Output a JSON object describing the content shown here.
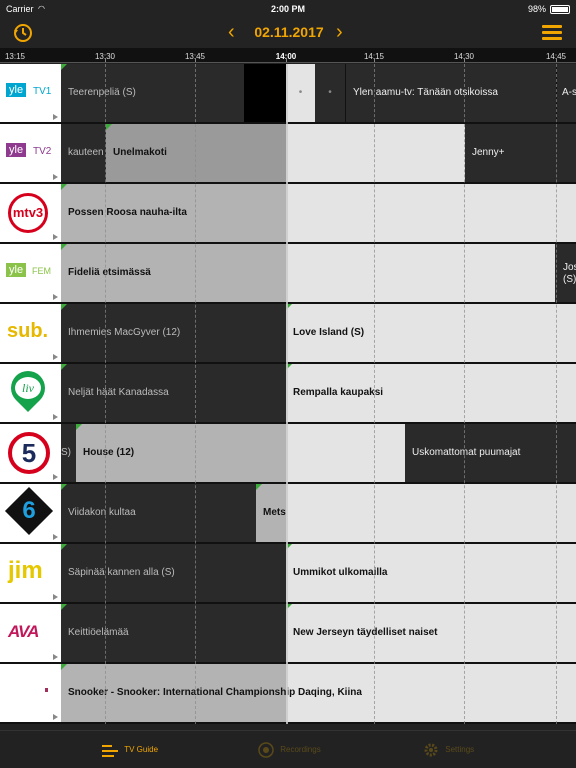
{
  "status": {
    "carrier": "Carrier",
    "time": "2:00 PM",
    "battery": "98%"
  },
  "nav": {
    "date": "02.11.2017",
    "history_icon": "history-clock-icon",
    "menu_icon": "hamburger-menu-icon"
  },
  "ruler": {
    "ticks": [
      "13:15",
      "13:30",
      "13:45",
      "14:00",
      "14:15",
      "14:30",
      "14:45"
    ],
    "current": "14:00"
  },
  "channels": [
    {
      "name": "yle-tv1",
      "logo_text": "yle",
      "logo_sub": "TV1",
      "programs": [
        "Teerenpeliä (S)",
        "•",
        "•",
        "Ylen aamu-tv: Tänään otsikoissa",
        "A-s"
      ]
    },
    {
      "name": "yle-tv2",
      "logo_text": "yle",
      "logo_sub": "TV2",
      "programs": [
        "kauteen",
        "Unelmakoti",
        "Jenny+"
      ]
    },
    {
      "name": "mtv3",
      "logo_text": "mtv3",
      "programs": [
        "Possen Roosa nauha-ilta"
      ]
    },
    {
      "name": "yle-fem",
      "logo_text": "yle",
      "logo_sub": "FEM",
      "programs": [
        "Fideliä etsimässä",
        "Jos",
        "(S)"
      ]
    },
    {
      "name": "sub",
      "logo_text": "sub.",
      "programs": [
        "Ihmemies MacGyver (12)",
        "Love Island (S)"
      ]
    },
    {
      "name": "liv",
      "logo_text": "liv",
      "programs": [
        "Neljät häät Kanadassa",
        "Rempalla kaupaksi"
      ]
    },
    {
      "name": "channel-5",
      "logo_text": "5",
      "programs": [
        "S)",
        "House (12)",
        "Uskomattomat puumajat"
      ]
    },
    {
      "name": "channel-6",
      "logo_text": "6",
      "programs": [
        "Viidakon kultaa",
        "Metsurit suolla"
      ]
    },
    {
      "name": "jim",
      "logo_text": "jim",
      "programs": [
        "Säpinää kannen alla (S)",
        "Ummikot ulkomailla"
      ]
    },
    {
      "name": "ava",
      "logo_text": "AVA",
      "programs": [
        "Keittiöelämää",
        "New Jerseyn täydelliset naiset"
      ]
    },
    {
      "name": "eurosport",
      "logo_text": "",
      "programs": [
        "Snooker - Snooker: International Championship Daqing, Kiina"
      ]
    }
  ],
  "tabs": [
    {
      "label": "TV Guide",
      "icon": "tv-guide-icon",
      "active": true
    },
    {
      "label": "Recordings",
      "icon": "record-icon",
      "active": false
    },
    {
      "label": "Settings",
      "icon": "gear-icon",
      "active": false
    }
  ],
  "colors": {
    "accent": "#f0a500",
    "yle": "#00a6cf",
    "mtv3": "#d6001c",
    "jim": "#e6c800",
    "liv_green": "#14a24a",
    "ava": "#c2185b"
  }
}
